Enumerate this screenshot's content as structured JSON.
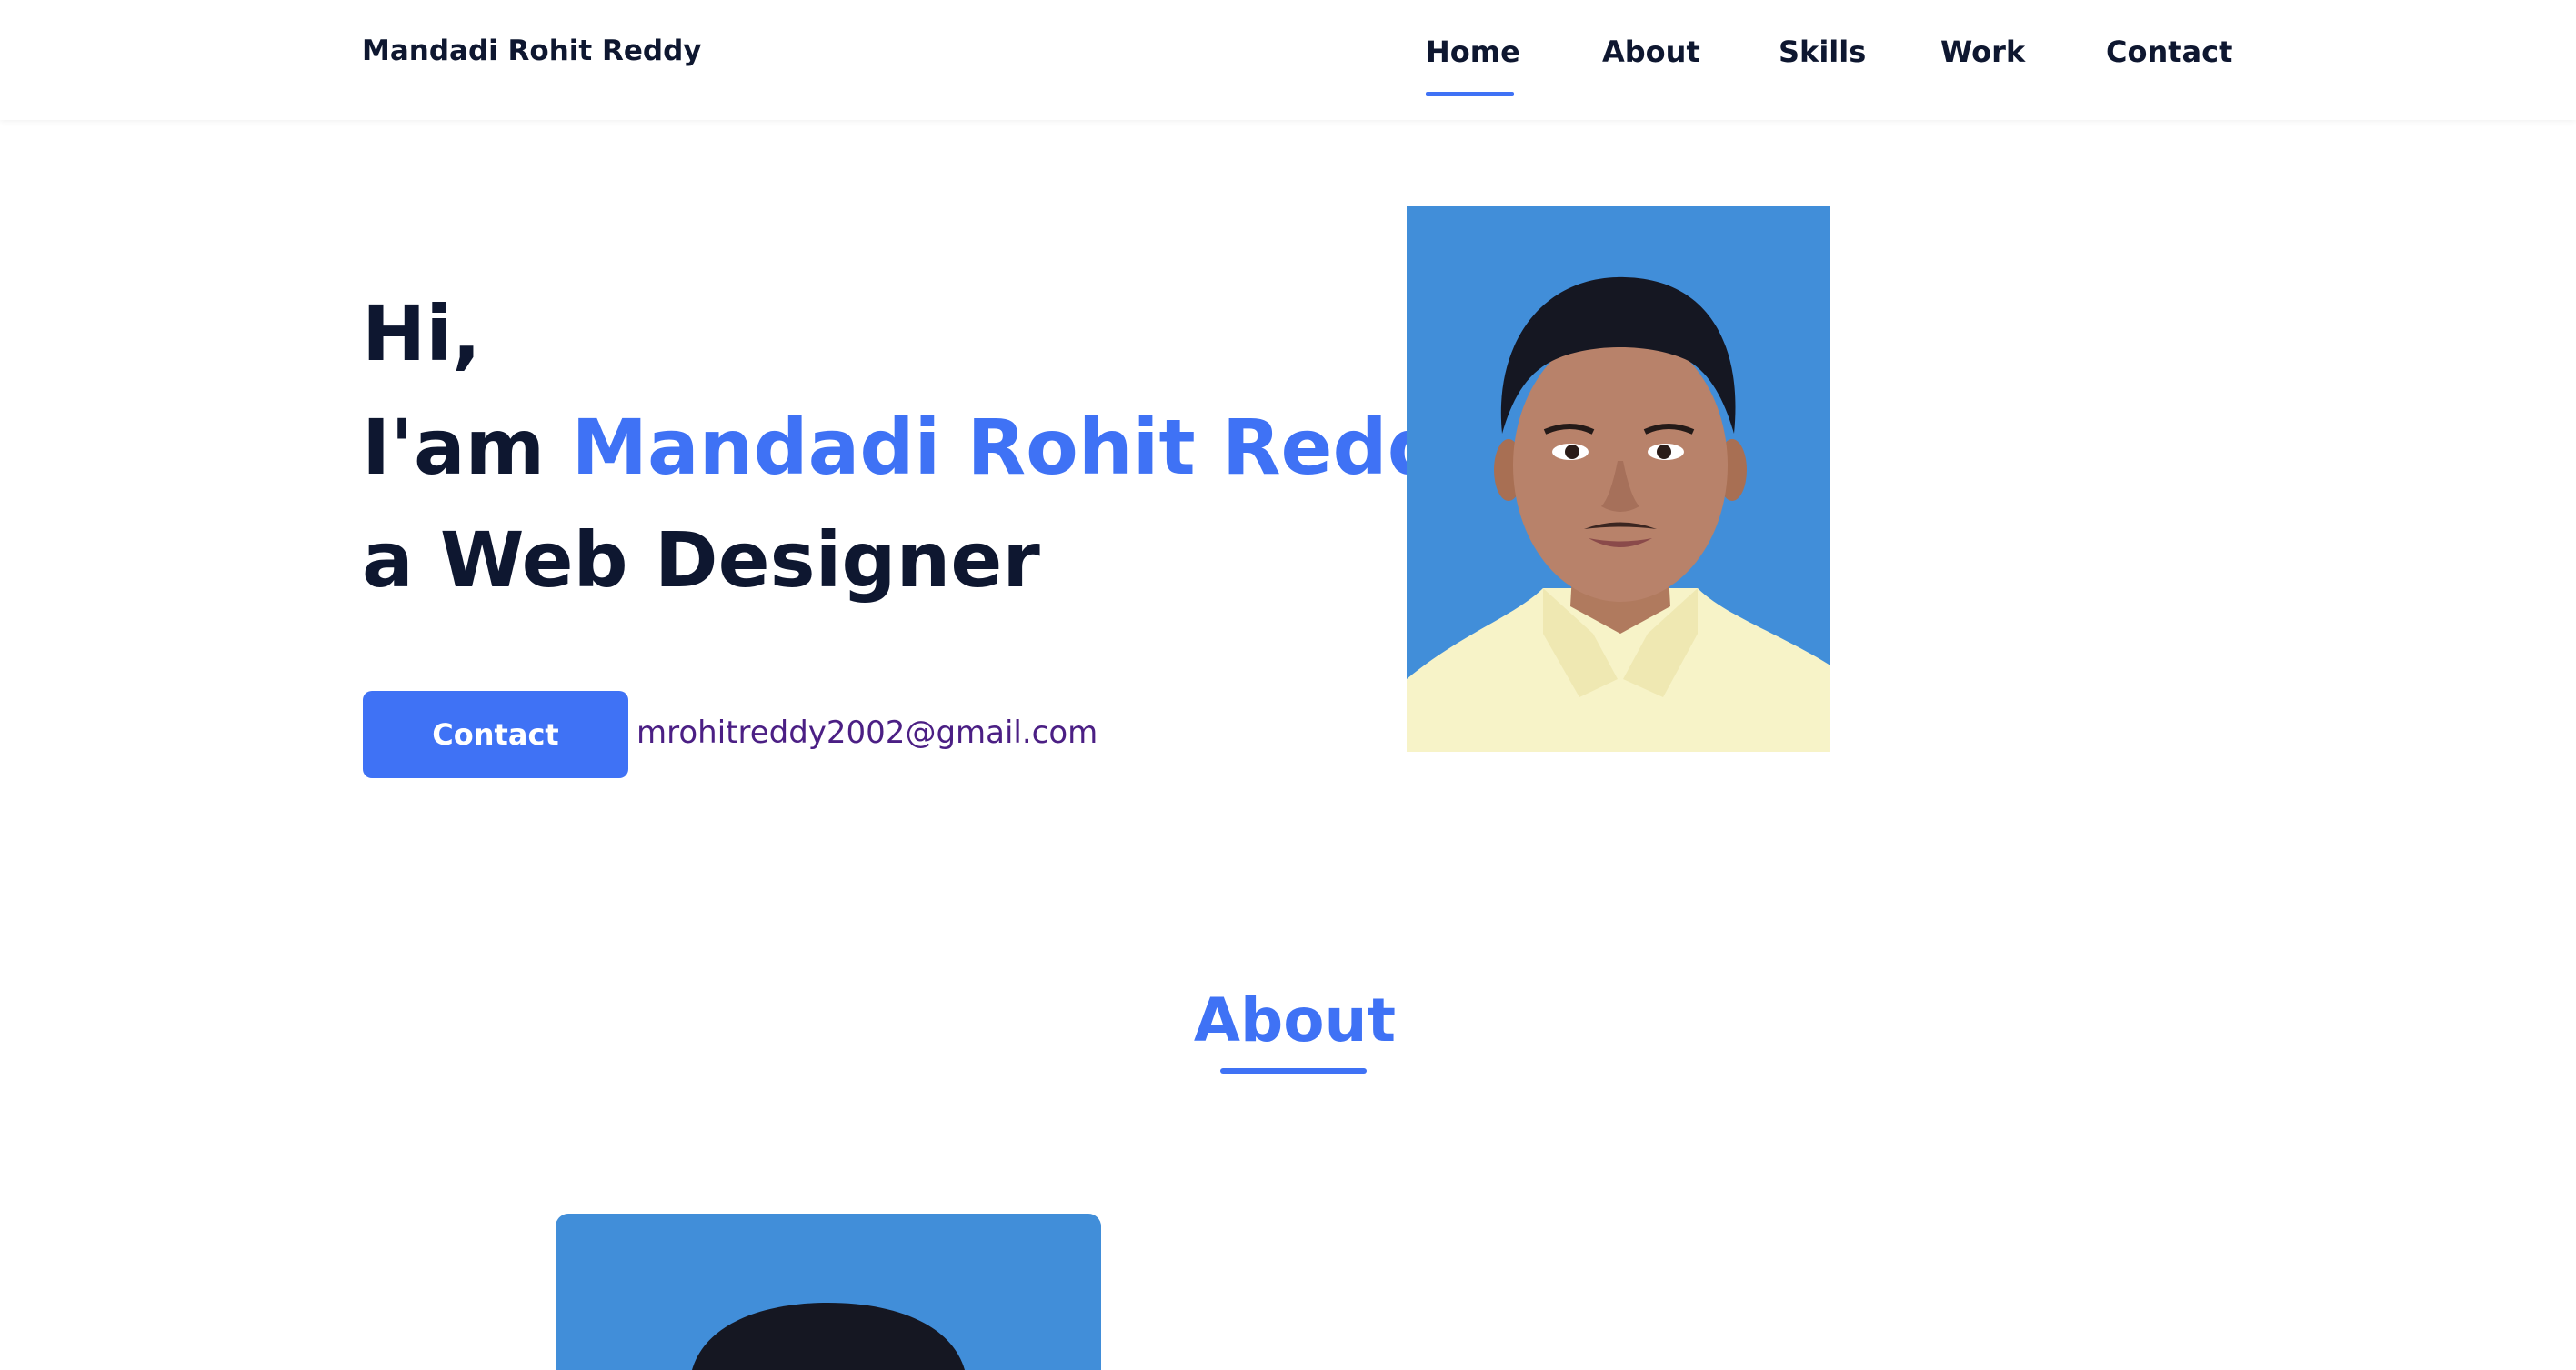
{
  "colors": {
    "accent": "#3f72f5",
    "text_dark": "#0e1730",
    "email": "#4b1f84",
    "photo_bg": "#418ed9"
  },
  "header": {
    "logo": "Mandadi Rohit Reddy",
    "nav": {
      "home": "Home",
      "about": "About",
      "skills": "Skills",
      "work": "Work",
      "contact": "Contact"
    },
    "active_nav": "Home"
  },
  "hero": {
    "greeting": "Hi,",
    "iam_prefix": "I'am ",
    "name": "Mandadi Rohit Reddy",
    "role": "a Web Designer",
    "contact_button": "Contact",
    "email": "mrohitreddy2002@gmail.com",
    "photo_alt": "profile-photo"
  },
  "about": {
    "title": "About",
    "photo_alt": "about-photo"
  }
}
